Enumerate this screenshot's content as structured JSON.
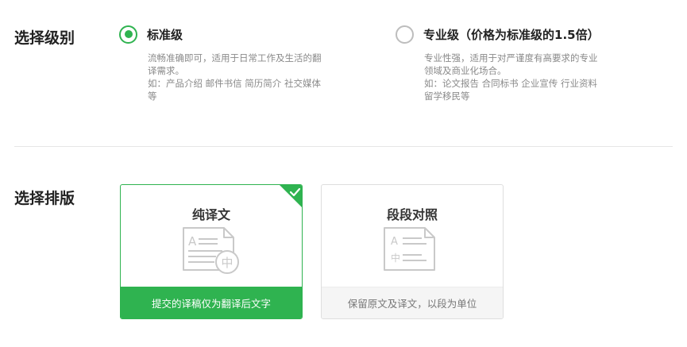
{
  "grade": {
    "label": "选择级别",
    "options": [
      {
        "title": "标准级",
        "selected": true,
        "desc": [
          "流畅准确即可，适用于日常工作及生活的翻",
          "译需求。",
          "如：产品介绍 邮件书信 简历简介 社交媒体",
          "等"
        ]
      },
      {
        "title": "专业级（价格为标准级的1.5倍）",
        "selected": false,
        "desc": [
          "专业性强，适用于对严谨度有高要求的专业",
          "领域及商业化场合。",
          "如：论文报告 合同标书 企业宣传 行业资料",
          "留学移民等"
        ]
      }
    ]
  },
  "layout": {
    "label": "选择排版",
    "cards": [
      {
        "title": "纯译文",
        "footer": "提交的译稿仅为翻译后文字",
        "selected": true,
        "icon": "translated-document-icon"
      },
      {
        "title": "段段对照",
        "footer": "保留原文及译文，以段为单位",
        "selected": false,
        "icon": "bilingual-document-icon"
      }
    ]
  },
  "colors": {
    "accent": "#2fb350",
    "icon_gray": "#c9c9c9"
  }
}
